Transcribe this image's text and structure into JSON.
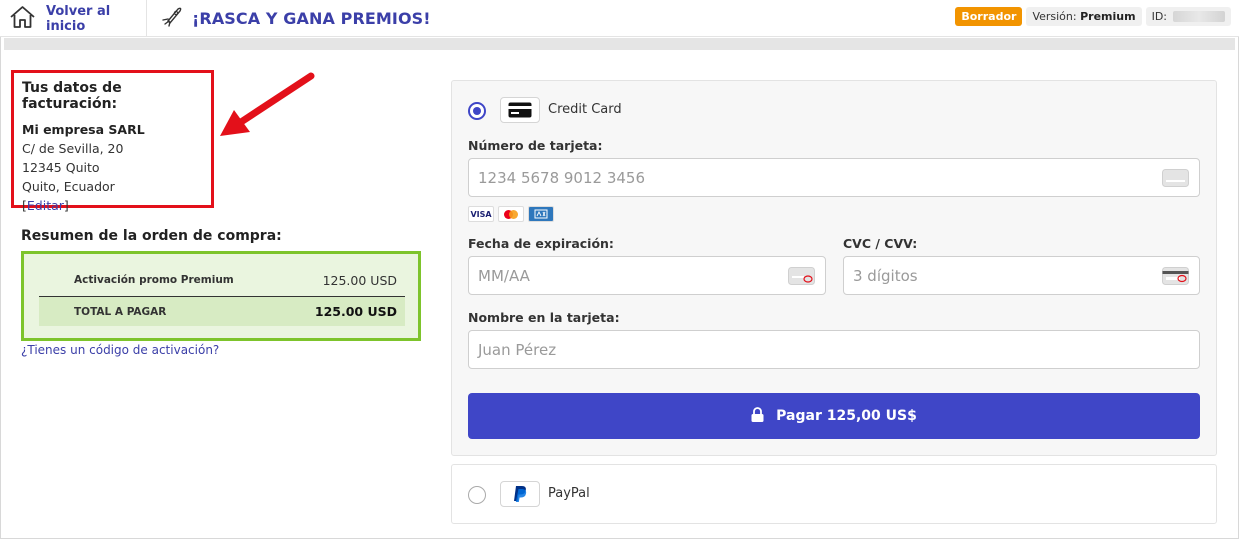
{
  "header": {
    "home_label": "Volver al inicio",
    "game_title": "¡RASCA Y GANA PREMIOS!",
    "draft_badge": "Borrador",
    "version_label": "Versión:",
    "version_value": "Premium",
    "id_label": "ID:"
  },
  "billing": {
    "title": "Tus datos de facturación:",
    "company": "Mi empresa SARL",
    "street": "C/ de Sevilla, 20",
    "postal_city": "12345 Quito",
    "city_country": "Quito, Ecuador",
    "edit_open": "[",
    "edit_label": "Editar",
    "edit_close": "]"
  },
  "summary": {
    "title": "Resumen de la orden de compra:",
    "item_label": "Activación promo Premium",
    "item_value": "125.00 USD",
    "total_label": "TOTAL A PAGAR",
    "total_value": "125.00 USD",
    "activation_link": "¿Tienes un código de activación?"
  },
  "payment": {
    "credit_card_label": "Credit Card",
    "card_number_label": "Número de tarjeta:",
    "card_number_placeholder": "1234 5678 9012 3456",
    "brands": [
      "VISA",
      "MC",
      "AMEX"
    ],
    "expiry_label": "Fecha de expiración:",
    "expiry_placeholder": "MM/AA",
    "cvc_label": "CVC / CVV:",
    "cvc_placeholder": "3 dígitos",
    "name_label": "Nombre en la tarjeta:",
    "name_placeholder": "Juan Pérez",
    "pay_button": "Pagar 125,00 US$",
    "paypal_label": "PayPal"
  },
  "colors": {
    "accent": "#3f46c7",
    "draft": "#f29400",
    "highlight_red": "#e3101a",
    "summary_green": "#7dc42b"
  }
}
